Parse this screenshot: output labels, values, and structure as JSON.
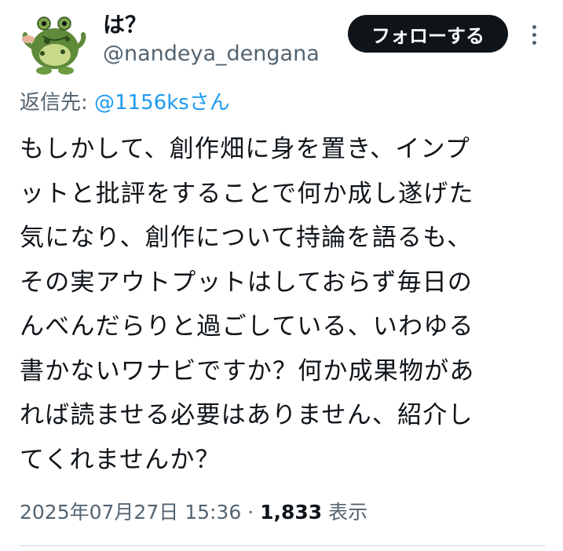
{
  "author": {
    "display_name": "は？",
    "handle": "@nandeya_dengana",
    "avatar_icon": "frog-icon"
  },
  "follow_label": "フォローする",
  "more_icon": "more-options-icon",
  "reply": {
    "prefix": "返信先: ",
    "target": "@1156ksさん"
  },
  "tweet_text": "もしかして、創作畑に身を置き、インプ\nットと批評をすることで何か成し遂げた\n気になり、創作について持論を語るも、\nその実アウトプットはしておらず毎日の\nんべんだらりと過ごしている、いわゆる\n書かないワナビですか？何か成果物があ\nれば読ませる必要はありません、紹介し\nてくれませんか？",
  "meta": {
    "timestamp": "2025年07月27日 15:36",
    "separator": " · ",
    "views_count": "1,833",
    "views_label": " 表示"
  },
  "colors": {
    "text": "#0f1419",
    "secondary": "#536471",
    "link": "#1d9bf0",
    "button_bg": "#0f1419",
    "divider": "#cfd9de"
  }
}
